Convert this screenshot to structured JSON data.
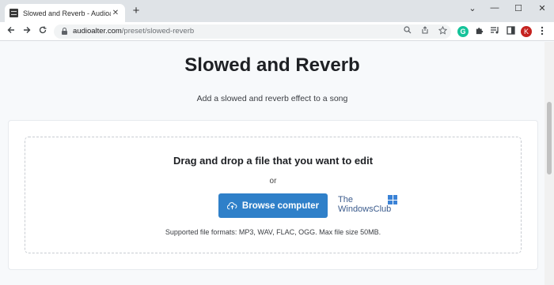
{
  "browser": {
    "tab_title": "Slowed and Reverb - Audioalter",
    "tab_close": "✕",
    "new_tab": "+",
    "window_controls": {
      "collapse": "⌄",
      "minimize": "—",
      "maximize": "☐",
      "close": "✕"
    },
    "url_domain": "audioalter.com",
    "url_path": "/preset/slowed-reverb",
    "profile_initial": "K",
    "extension_grammarly": "G",
    "icons": {
      "back": "back-arrow-icon",
      "forward": "forward-arrow-icon",
      "reload": "reload-icon",
      "lock": "lock-icon",
      "search": "search-icon",
      "share": "share-icon",
      "bookmark": "star-icon",
      "extensions": "puzzle-icon",
      "media": "media-queue-icon",
      "sidepanel": "side-panel-icon",
      "menu": "kebab-menu-icon"
    }
  },
  "page": {
    "heading": "Slowed and Reverb",
    "subtitle": "Add a slowed and reverb effect to a song",
    "dropzone": {
      "title": "Drag and drop a file that you want to edit",
      "or": "or",
      "browse_label": "Browse computer",
      "formats": "Supported file formats: MP3, WAV, FLAC, OGG. Max file size 50MB."
    }
  },
  "watermark": {
    "line1": "The",
    "line2": "WindowsClub"
  },
  "colors": {
    "accent": "#2f80c9",
    "heading": "#1e2024",
    "background": "#f7f9fb"
  }
}
